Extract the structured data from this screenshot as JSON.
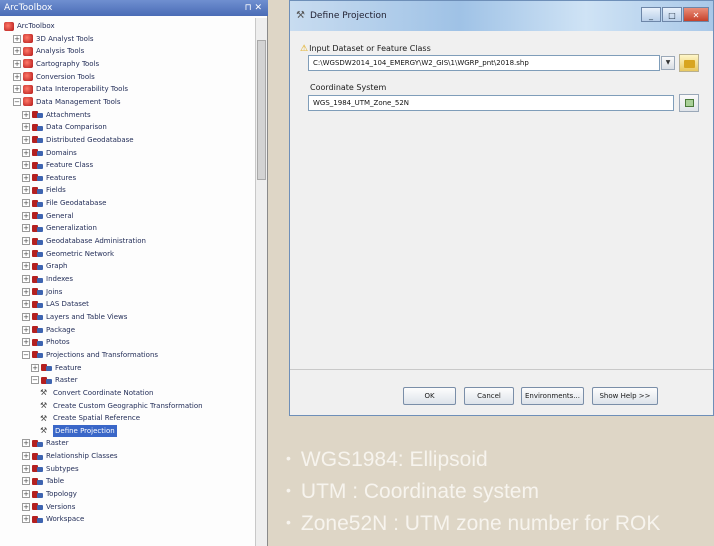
{
  "toolbox": {
    "title": "ArcToolbox",
    "pin": "⊓ ✕",
    "items": [
      {
        "label": "ArcToolbox",
        "icon": "toolbox-root",
        "level": 0,
        "expander": ""
      },
      {
        "label": "3D Analyst Tools",
        "icon": "toolbox",
        "level": 1,
        "expander": "+"
      },
      {
        "label": "Analysis Tools",
        "icon": "toolbox",
        "level": 1,
        "expander": "+"
      },
      {
        "label": "Cartography Tools",
        "icon": "toolbox",
        "level": 1,
        "expander": "+"
      },
      {
        "label": "Conversion Tools",
        "icon": "toolbox",
        "level": 1,
        "expander": "+"
      },
      {
        "label": "Data Interoperability Tools",
        "icon": "toolbox",
        "level": 1,
        "expander": "+"
      },
      {
        "label": "Data Management Tools",
        "icon": "toolbox",
        "level": 1,
        "expander": "−"
      },
      {
        "label": "Attachments",
        "icon": "toolset",
        "level": 2,
        "expander": "+"
      },
      {
        "label": "Data Comparison",
        "icon": "toolset",
        "level": 2,
        "expander": "+"
      },
      {
        "label": "Distributed Geodatabase",
        "icon": "toolset",
        "level": 2,
        "expander": "+"
      },
      {
        "label": "Domains",
        "icon": "toolset",
        "level": 2,
        "expander": "+"
      },
      {
        "label": "Feature Class",
        "icon": "toolset",
        "level": 2,
        "expander": "+"
      },
      {
        "label": "Features",
        "icon": "toolset",
        "level": 2,
        "expander": "+"
      },
      {
        "label": "Fields",
        "icon": "toolset",
        "level": 2,
        "expander": "+"
      },
      {
        "label": "File Geodatabase",
        "icon": "toolset",
        "level": 2,
        "expander": "+"
      },
      {
        "label": "General",
        "icon": "toolset",
        "level": 2,
        "expander": "+"
      },
      {
        "label": "Generalization",
        "icon": "toolset",
        "level": 2,
        "expander": "+"
      },
      {
        "label": "Geodatabase Administration",
        "icon": "toolset",
        "level": 2,
        "expander": "+"
      },
      {
        "label": "Geometric Network",
        "icon": "toolset",
        "level": 2,
        "expander": "+"
      },
      {
        "label": "Graph",
        "icon": "toolset",
        "level": 2,
        "expander": "+"
      },
      {
        "label": "Indexes",
        "icon": "toolset",
        "level": 2,
        "expander": "+"
      },
      {
        "label": "Joins",
        "icon": "toolset",
        "level": 2,
        "expander": "+"
      },
      {
        "label": "LAS Dataset",
        "icon": "toolset",
        "level": 2,
        "expander": "+"
      },
      {
        "label": "Layers and Table Views",
        "icon": "toolset",
        "level": 2,
        "expander": "+"
      },
      {
        "label": "Package",
        "icon": "toolset",
        "level": 2,
        "expander": "+"
      },
      {
        "label": "Photos",
        "icon": "toolset",
        "level": 2,
        "expander": "+"
      },
      {
        "label": "Projections and Transformations",
        "icon": "toolset",
        "level": 2,
        "expander": "−"
      },
      {
        "label": "Feature",
        "icon": "toolset",
        "level": 3,
        "expander": "+"
      },
      {
        "label": "Raster",
        "icon": "toolset",
        "level": 3,
        "expander": "−"
      },
      {
        "label": "Convert Coordinate Notation",
        "icon": "tool",
        "level": 4,
        "expander": ""
      },
      {
        "label": "Create Custom Geographic Transformation",
        "icon": "tool",
        "level": 4,
        "expander": ""
      },
      {
        "label": "Create Spatial Reference",
        "icon": "tool",
        "level": 4,
        "expander": ""
      },
      {
        "label": "Define Projection",
        "icon": "tool",
        "level": 4,
        "expander": "",
        "selected": true
      },
      {
        "label": "Raster",
        "icon": "toolset",
        "level": 2,
        "expander": "+"
      },
      {
        "label": "Relationship Classes",
        "icon": "toolset",
        "level": 2,
        "expander": "+"
      },
      {
        "label": "Subtypes",
        "icon": "toolset",
        "level": 2,
        "expander": "+"
      },
      {
        "label": "Table",
        "icon": "toolset",
        "level": 2,
        "expander": "+"
      },
      {
        "label": "Topology",
        "icon": "toolset",
        "level": 2,
        "expander": "+"
      },
      {
        "label": "Versions",
        "icon": "toolset",
        "level": 2,
        "expander": "+"
      },
      {
        "label": "Workspace",
        "icon": "toolset",
        "level": 2,
        "expander": "+"
      }
    ]
  },
  "dialog": {
    "title": "Define Projection",
    "controls": {
      "minimize": "_",
      "maximize": "□",
      "close": "✕"
    },
    "input_label": "Input Dataset or Feature Class",
    "input_value": "C:\\WGSDW2014_104_EMERGY\\W2_GIS\\1\\WGRP_pnt\\2018.shp",
    "coord_label": "Coordinate System",
    "coord_value": "WGS_1984_UTM_Zone_52N",
    "buttons": {
      "ok": "OK",
      "cancel": "Cancel",
      "environments": "Environments...",
      "show_help": "Show Help >>"
    }
  },
  "notes": [
    "WGS1984: Ellipsoid",
    "UTM : Coordinate system",
    "Zone52N : UTM zone number for ROK"
  ],
  "colors": {
    "selection": "#3a67c8",
    "title_bar": "#9fc2e6",
    "slide_bg": "#ded6c6"
  }
}
